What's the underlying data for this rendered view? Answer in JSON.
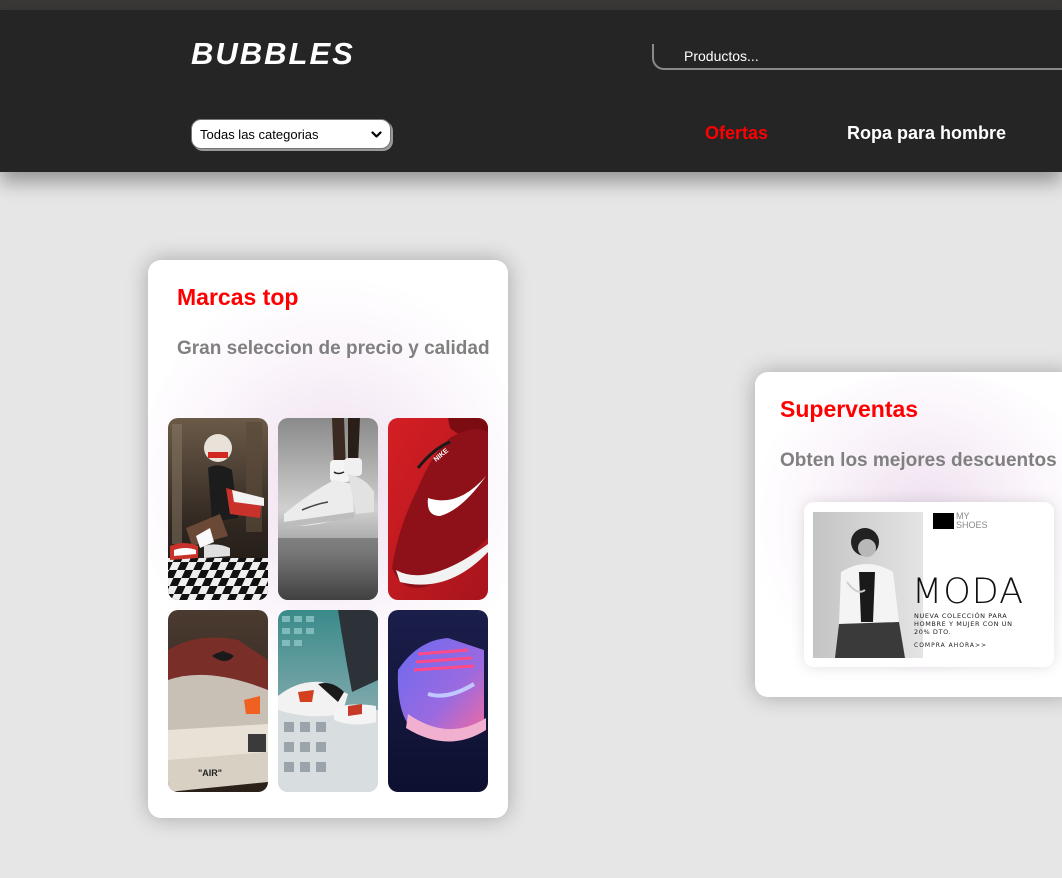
{
  "header": {
    "logo": "BUBBLES",
    "search_placeholder": "Productos...",
    "category_select": "Todas las categorias",
    "nav": [
      {
        "label": "Ofertas",
        "color": "#ff0000"
      },
      {
        "label": "Ropa para hombre",
        "color": "#ffffff"
      }
    ]
  },
  "cards": [
    {
      "title": "Marcas top",
      "subtitle": "Gran seleccion de precio y calidad",
      "images": [
        "sneaker-photo-woman-sitting-checkered-floor",
        "sneaker-photo-white-nike-socks",
        "sneaker-photo-red-nike-runner",
        "sneaker-photo-air-jordan-closeup",
        "sneaker-photo-jordan-on-building",
        "sneaker-photo-neon-blue-sneaker"
      ]
    },
    {
      "title": "Superventas",
      "subtitle": "Obten los mejores descuentos",
      "promo": {
        "brand": "MY SHOES",
        "headline": "MODA",
        "description": "NUEVA COLECCIÓN PARA HOMBRE Y MUJER CON UN 20% DTO.",
        "cta": "COMPRA AHORA>>"
      }
    }
  ],
  "colors": {
    "header_bg": "#252525",
    "accent": "#ff0000",
    "page_bg": "#e6e6e6",
    "subtitle": "#808080"
  }
}
